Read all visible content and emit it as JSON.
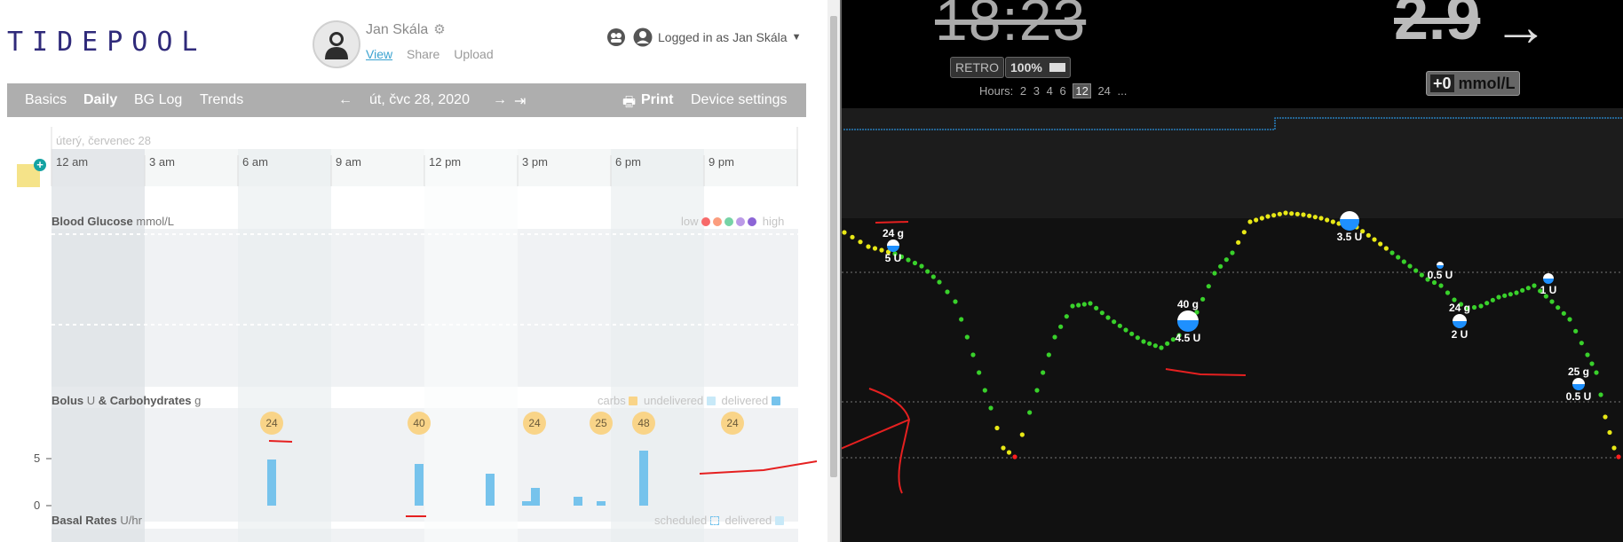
{
  "tidepool": {
    "logo": "TIDEPOOL",
    "user_name": "Jan Skála",
    "profile_links": {
      "view": "View",
      "share": "Share",
      "upload": "Upload"
    },
    "logged_in_text": "Logged in as Jan Skála",
    "nav": {
      "basics": "Basics",
      "daily": "Daily",
      "bg_log": "BG Log",
      "trends": "Trends",
      "date": "út, čvc 28, 2020",
      "print": "Print",
      "device_settings": "Device settings"
    },
    "day_label": "úterý, červenec 28",
    "hours": [
      "12 am",
      "3 am",
      "6 am",
      "9 am",
      "12 pm",
      "3 pm",
      "6 pm",
      "9 pm"
    ],
    "blood_glucose": {
      "title": "Blood Glucose",
      "unit": "mmol/L",
      "legend_low": "low",
      "legend_high": "high",
      "legend_colors": [
        "#f76a6a",
        "#fb9d7e",
        "#76d3a6",
        "#bb9ae7",
        "#8c65d6"
      ]
    },
    "bolus": {
      "title": "Bolus",
      "unit_u": "U",
      "amp": "&",
      "carbs_label": "Carbohydrates",
      "unit_g": "g",
      "legend_carbs": "carbs",
      "legend_undelivered": "undelivered",
      "legend_delivered": "delivered",
      "carbs": [
        24,
        40,
        24,
        25,
        48,
        24
      ],
      "y_ticks": [
        "5",
        "0"
      ],
      "bolus_units": [
        5,
        4.5,
        3.5,
        0.5,
        2,
        0.5,
        6
      ]
    },
    "basal": {
      "title": "Basal Rates",
      "unit": "U/hr",
      "legend_scheduled": "scheduled",
      "legend_delivered": "delivered"
    },
    "colors": {
      "nav_bg": "#aeaeae",
      "carb": "#f9d488",
      "bolus": "#76c3ec",
      "logo": "#2f2a7a"
    }
  },
  "nightscout": {
    "time": "18:23",
    "glucose": "2.9",
    "arrow": "→",
    "retro_label": "RETRO",
    "battery": "100%",
    "delta": "+0",
    "delta_unit": "mmol/L",
    "hours_label": "Hours:",
    "hour_options": [
      "2",
      "3",
      "4",
      "6",
      "12",
      "24",
      "..."
    ],
    "active_hours": "12",
    "annotations": [
      {
        "carbs": "24 g",
        "insulin": "5 U"
      },
      {
        "carbs": "40 g",
        "insulin": "4.5 U"
      },
      {
        "carbs": "",
        "insulin": "3.5 U"
      },
      {
        "carbs": "",
        "insulin": "0.5 U"
      },
      {
        "carbs": "24 g",
        "insulin": "2 U"
      },
      {
        "carbs": "",
        "insulin": "1 U"
      },
      {
        "carbs": "25 g",
        "insulin": "0.5 U"
      }
    ],
    "colors": {
      "in_range": "#39d12b",
      "high": "#e8e816",
      "low": "#ff2020",
      "basal_line": "#2a8fd8"
    }
  }
}
